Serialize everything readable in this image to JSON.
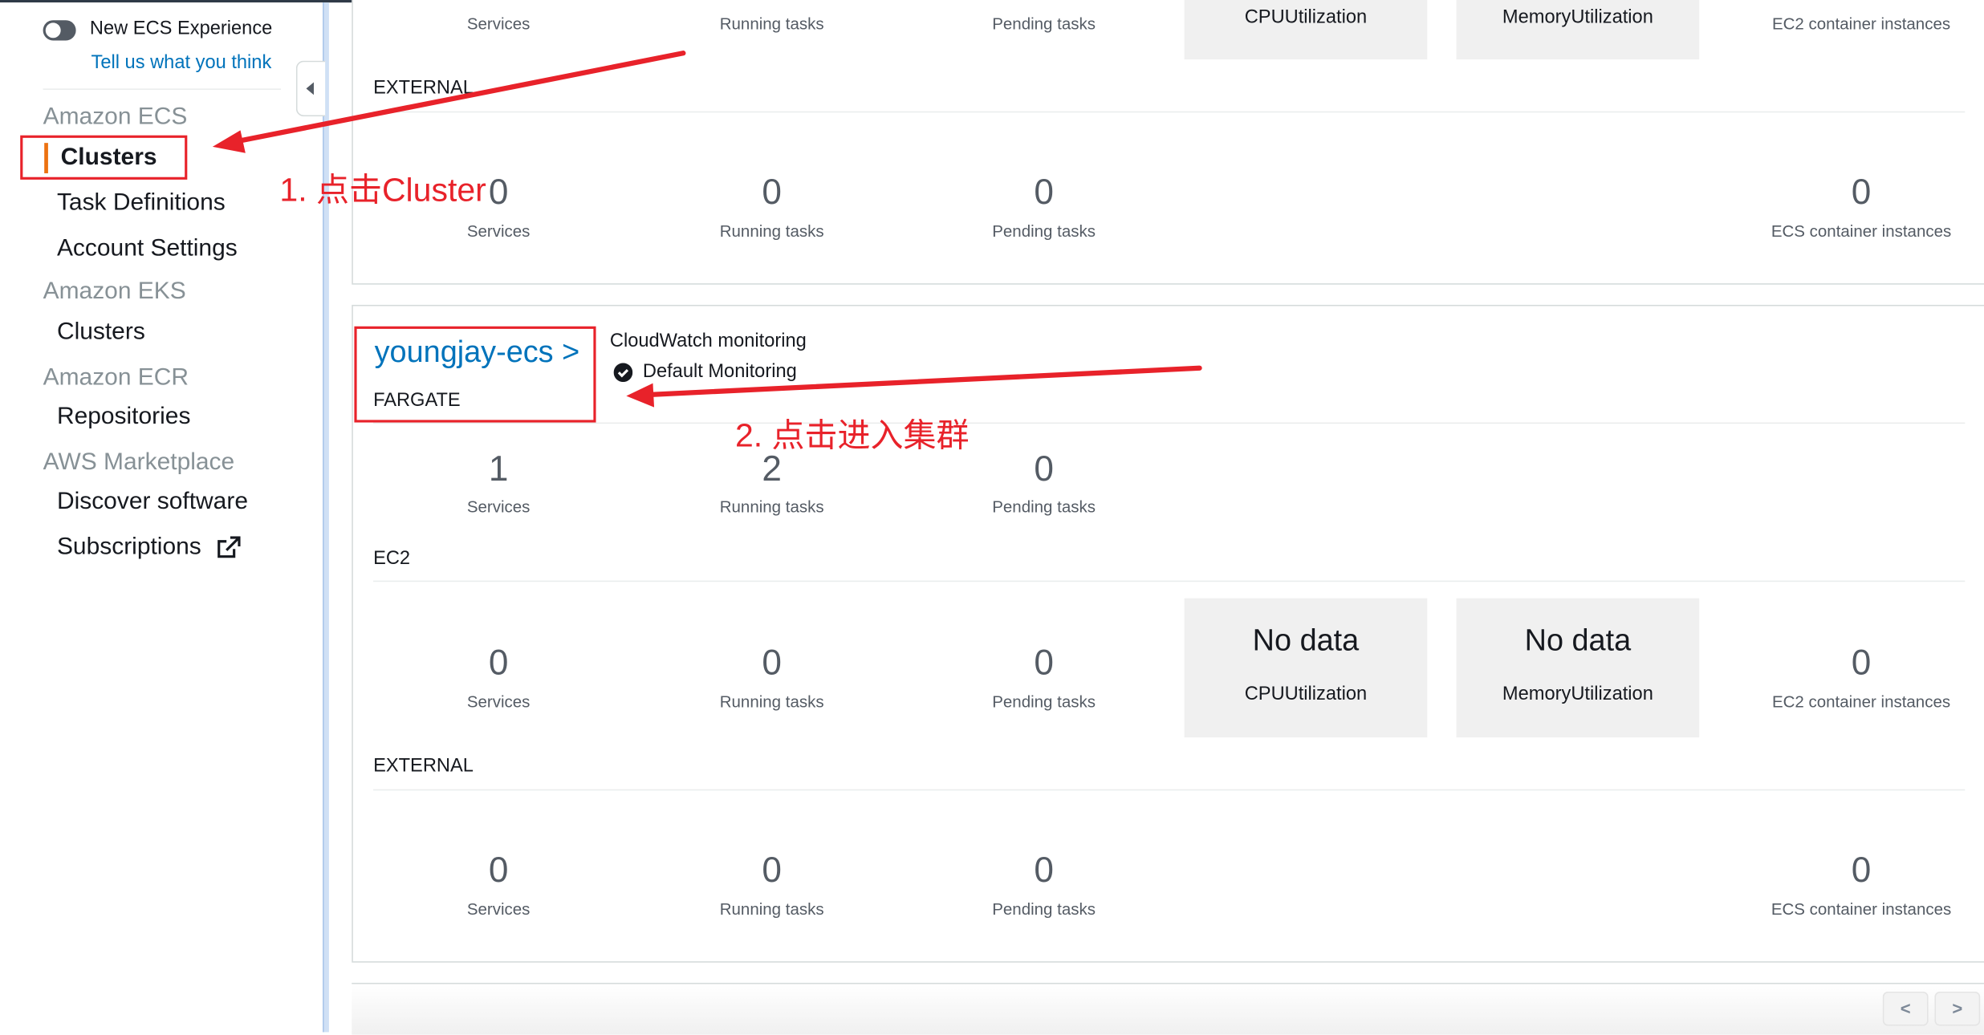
{
  "sidebar": {
    "toggle_label": "New ECS Experience",
    "feedback_link": "Tell us what you think",
    "sections": [
      {
        "title": "Amazon ECS",
        "items": [
          "Clusters",
          "Task Definitions",
          "Account Settings"
        ]
      },
      {
        "title": "Amazon EKS",
        "items": [
          "Clusters"
        ]
      },
      {
        "title": "Amazon ECR",
        "items": [
          "Repositories"
        ]
      },
      {
        "title": "AWS Marketplace",
        "items": [
          "Discover software",
          "Subscriptions"
        ]
      }
    ],
    "active_color": "#ec7211"
  },
  "cluster1": {
    "header": {
      "services": "Services",
      "running": "Running tasks",
      "pending": "Pending tasks",
      "cpu": "CPUUtilization",
      "memory": "MemoryUtilization",
      "instances": "EC2 container instances"
    },
    "external": {
      "label": "EXTERNAL",
      "services": "0",
      "services_label": "Services",
      "running": "0",
      "running_label": "Running tasks",
      "pending": "0",
      "pending_label": "Pending tasks",
      "instances": "0",
      "instances_label": "ECS container instances"
    }
  },
  "cluster2": {
    "name": "youngjay-ecs >",
    "type": "FARGATE",
    "monitoring_title": "CloudWatch monitoring",
    "monitoring_value": "Default Monitoring",
    "fargate": {
      "services": "1",
      "services_label": "Services",
      "running": "2",
      "running_label": "Running tasks",
      "pending": "0",
      "pending_label": "Pending tasks"
    },
    "ec2": {
      "label": "EC2",
      "services": "0",
      "services_label": "Services",
      "running": "0",
      "running_label": "Running tasks",
      "pending": "0",
      "pending_label": "Pending tasks",
      "cpu_value": "No data",
      "cpu_label": "CPUUtilization",
      "mem_value": "No data",
      "mem_label": "MemoryUtilization",
      "instances": "0",
      "instances_label": "EC2 container instances"
    },
    "external": {
      "label": "EXTERNAL",
      "services": "0",
      "services_label": "Services",
      "running": "0",
      "running_label": "Running tasks",
      "pending": "0",
      "pending_label": "Pending tasks",
      "instances": "0",
      "instances_label": "ECS container instances"
    }
  },
  "pagination": {
    "prev": "<",
    "next": ">"
  },
  "annotations": {
    "step1": "1. 点击Cluster",
    "step2": "2. 点击进入集群",
    "color": "#e8222a"
  }
}
